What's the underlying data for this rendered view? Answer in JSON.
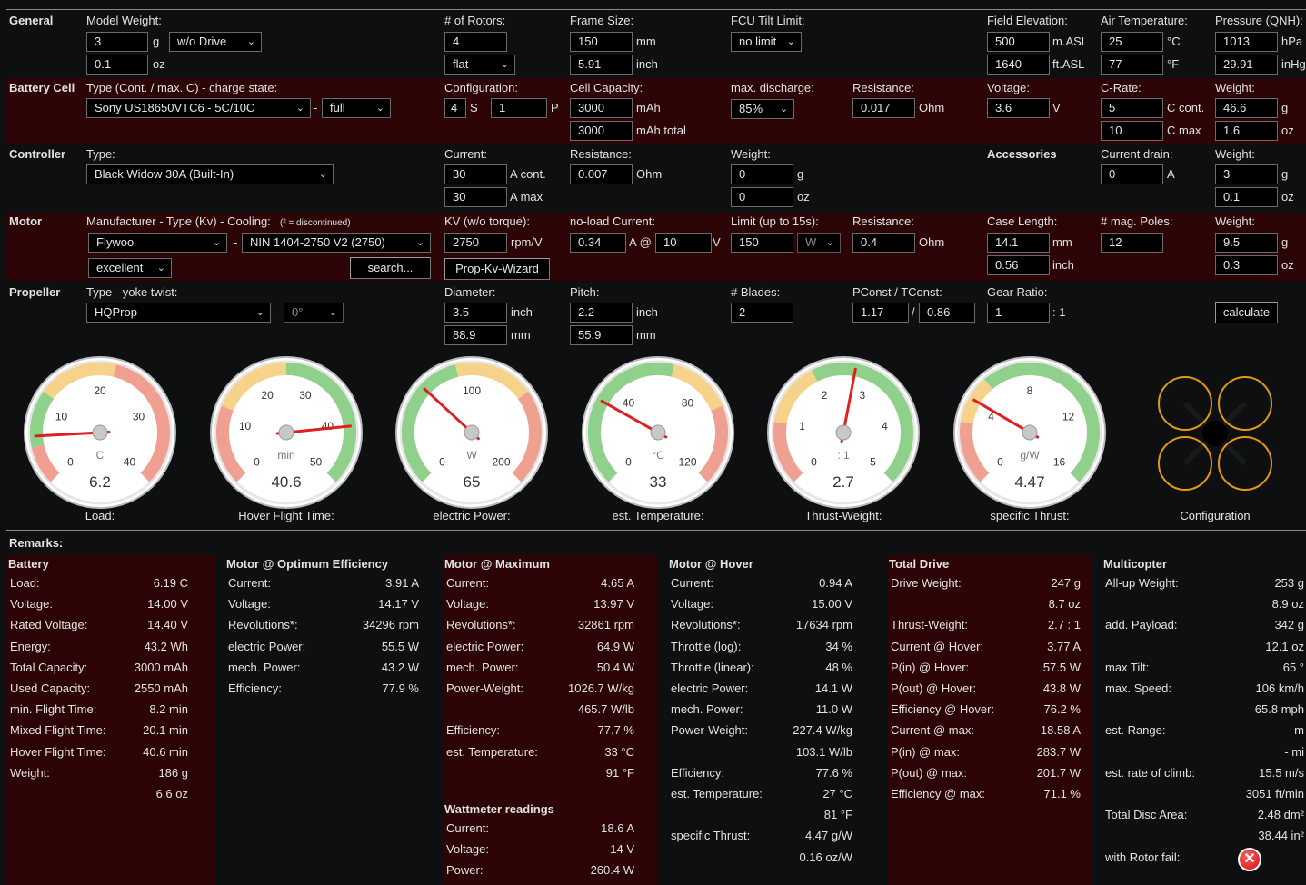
{
  "general": {
    "label": "General",
    "model_weight_label": "Model Weight:",
    "weight_g": "3",
    "unit_g": "g",
    "drive_select": "w/o Drive",
    "weight_oz": "0.1",
    "unit_oz": "oz",
    "rotors_label": "# of Rotors:",
    "rotors": "4",
    "rotor_layout": "flat",
    "frame_label": "Frame Size:",
    "frame_mm": "150",
    "unit_mm": "mm",
    "frame_inch": "5.91",
    "unit_inch": "inch",
    "fcu_label": "FCU Tilt Limit:",
    "fcu_select": "no limit",
    "elev_label": "Field Elevation:",
    "elev_m": "500",
    "unit_masl": "m.ASL",
    "elev_ft": "1640",
    "unit_ftasl": "ft.ASL",
    "air_label": "Air Temperature:",
    "air_c": "25",
    "unit_c": "°C",
    "air_f": "77",
    "unit_f": "°F",
    "pressure_label": "Pressure (QNH):",
    "pressure_hpa": "1013",
    "unit_hpa": "hPa",
    "pressure_inhg": "29.91",
    "unit_inhg": "inHg"
  },
  "battery": {
    "label": "Battery Cell",
    "type_label": "Type (Cont. / max. C) - charge state:",
    "type_select": "Sony US18650VTC6 - 5C/10C",
    "dash": "-",
    "charge_select": "full",
    "config_label": "Configuration:",
    "s_val": "4",
    "s_unit": "S",
    "p_val": "1",
    "p_unit": "P",
    "capacity_label": "Cell Capacity:",
    "capacity": "3000",
    "unit_mah": "mAh",
    "capacity_total": "3000",
    "unit_mah_total": "mAh total",
    "discharge_label": "max. discharge:",
    "discharge_select": "85%",
    "resistance_label": "Resistance:",
    "resistance": "0.017",
    "unit_ohm": "Ohm",
    "voltage_label": "Voltage:",
    "voltage": "3.6",
    "unit_v": "V",
    "crate_label": "C-Rate:",
    "c_cont": "5",
    "unit_ccont": "C cont.",
    "c_max": "10",
    "unit_cmax": "C max",
    "weight_label": "Weight:",
    "weight_g": "46.6",
    "unit_g": "g",
    "weight_oz": "1.6",
    "unit_oz": "oz"
  },
  "controller": {
    "label": "Controller",
    "type_label": "Type:",
    "type_select": "Black Widow 30A (Built-In)",
    "current_label": "Current:",
    "current_cont": "30",
    "unit_acont": "A cont.",
    "current_max": "30",
    "unit_amax": "A max",
    "resistance_label": "Resistance:",
    "resistance": "0.007",
    "unit_ohm": "Ohm",
    "weight_label": "Weight:",
    "weight_g": "0",
    "unit_g": "g",
    "weight_oz": "0",
    "unit_oz": "oz",
    "accessories_label": "Accessories",
    "drain_label": "Current drain:",
    "drain": "0",
    "unit_a": "A",
    "acc_weight_label": "Weight:",
    "acc_weight_g": "3",
    "acc_unit_g": "g",
    "acc_weight_oz": "0.1",
    "acc_unit_oz": "oz"
  },
  "motor": {
    "label": "Motor",
    "mfr_label": "Manufacturer - Type (Kv) - Cooling:",
    "discontinued_note": "(² = discontinued)",
    "mfr_select": "Flywoo",
    "dash": "-",
    "type_select": "NIN 1404-2750 V2 (2750)",
    "cooling_select": "excellent",
    "search_button": "search...",
    "kv_label": "KV (w/o torque):",
    "kv": "2750",
    "unit_rpmv": "rpm/V",
    "wizard_button": "Prop-Kv-Wizard",
    "noload_label": "no-load Current:",
    "noload_a": "0.34",
    "unit_a_at": "A @",
    "noload_v": "10",
    "unit_v": "V",
    "limit_label": "Limit (up to 15s):",
    "limit": "150",
    "limit_unit_select": "W",
    "resistance_label": "Resistance:",
    "resistance": "0.4",
    "unit_ohm": "Ohm",
    "case_label": "Case Length:",
    "case_mm": "14.1",
    "unit_mm": "mm",
    "case_inch": "0.56",
    "unit_inch": "inch",
    "poles_label": "# mag. Poles:",
    "poles": "12",
    "weight_label": "Weight:",
    "weight_g": "9.5",
    "unit_g": "g",
    "weight_oz": "0.3",
    "unit_oz": "oz"
  },
  "propeller": {
    "label": "Propeller",
    "type_label": "Type - yoke twist:",
    "type_select": "HQProp",
    "dash": "-",
    "twist_select": "0°",
    "diameter_label": "Diameter:",
    "diameter_inch": "3.5",
    "unit_inch": "inch",
    "diameter_mm": "88.9",
    "unit_mm": "mm",
    "pitch_label": "Pitch:",
    "pitch_inch": "2.2",
    "pitch_unit_inch": "inch",
    "pitch_mm": "55.9",
    "pitch_unit_mm": "mm",
    "blades_label": "# Blades:",
    "blades": "2",
    "pconst_label": "PConst / TConst:",
    "pconst": "1.17",
    "slash": "/",
    "tconst": "0.86",
    "gear_label": "Gear Ratio:",
    "gear": "1",
    "gear_unit": ": 1",
    "calculate_button": "calculate"
  },
  "gauges": [
    {
      "id": "load",
      "value": "6.2",
      "unit": "C",
      "label": "Load:",
      "ticks": [
        "0",
        "10",
        "20",
        "30",
        "40"
      ],
      "needle": 0.155
    },
    {
      "id": "hover",
      "value": "40.6",
      "unit": "min",
      "label": "Hover Flight Time:",
      "ticks": [
        "0",
        "10",
        "20",
        "30",
        "40",
        "50"
      ],
      "needle": 0.812
    },
    {
      "id": "power",
      "value": "65",
      "unit": "W",
      "label": "electric Power:",
      "ticks": [
        "0",
        "100",
        "200"
      ],
      "needle": 0.325
    },
    {
      "id": "temp",
      "value": "33",
      "unit": "°C",
      "label": "est. Temperature:",
      "ticks": [
        "0",
        "40",
        "80",
        "120"
      ],
      "needle": 0.275
    },
    {
      "id": "thrust",
      "value": "2.7",
      "unit": ": 1",
      "label": "Thrust-Weight:",
      "ticks": [
        "0",
        "1",
        "2",
        "3",
        "4",
        "5"
      ],
      "needle": 0.54
    },
    {
      "id": "specific",
      "value": "4.47",
      "unit": "g/W",
      "label": "specific Thrust:",
      "ticks": [
        "0",
        "4",
        "8",
        "12",
        "16"
      ],
      "needle": 0.279
    }
  ],
  "config_label": "Configuration",
  "remarks_label": "Remarks:",
  "results": {
    "battery": {
      "title": "Battery",
      "rows": [
        [
          "Load:",
          "6.19 C"
        ],
        [
          "Voltage:",
          "14.00 V"
        ],
        [
          "Rated Voltage:",
          "14.40 V"
        ],
        [
          "Energy:",
          "43.2 Wh"
        ],
        [
          "Total Capacity:",
          "3000 mAh"
        ],
        [
          "Used Capacity:",
          "2550 mAh"
        ],
        [
          "min. Flight Time:",
          "8.2 min"
        ],
        [
          "Mixed Flight Time:",
          "20.1 min"
        ],
        [
          "Hover Flight Time:",
          "40.6 min"
        ],
        [
          "Weight:",
          "186 g"
        ],
        [
          "",
          "6.6 oz"
        ]
      ]
    },
    "optimum": {
      "title": "Motor @ Optimum Efficiency",
      "rows": [
        [
          "Current:",
          "3.91 A"
        ],
        [
          "Voltage:",
          "14.17 V"
        ],
        [
          "Revolutions*:",
          "34296 rpm"
        ],
        [
          "electric Power:",
          "55.5 W"
        ],
        [
          "mech. Power:",
          "43.2 W"
        ],
        [
          "Efficiency:",
          "77.9 %"
        ]
      ]
    },
    "maximum": {
      "title": "Motor @ Maximum",
      "rows": [
        [
          "Current:",
          "4.65 A"
        ],
        [
          "Voltage:",
          "13.97 V"
        ],
        [
          "Revolutions*:",
          "32861 rpm"
        ],
        [
          "electric Power:",
          "64.9 W"
        ],
        [
          "mech. Power:",
          "50.4 W"
        ],
        [
          "Power-Weight:",
          "1026.7 W/kg"
        ],
        [
          "",
          "465.7 W/lb"
        ],
        [
          "Efficiency:",
          "77.7 %"
        ],
        [
          "est. Temperature:",
          "33 °C"
        ],
        [
          "",
          "91 °F"
        ]
      ],
      "watt_title": "Wattmeter readings",
      "watt_rows": [
        [
          "Current:",
          "18.6 A"
        ],
        [
          "Voltage:",
          "14 V"
        ],
        [
          "Power:",
          "260.4 W"
        ]
      ]
    },
    "hover": {
      "title": "Motor @ Hover",
      "rows": [
        [
          "Current:",
          "0.94 A"
        ],
        [
          "Voltage:",
          "15.00 V"
        ],
        [
          "Revolutions*:",
          "17634 rpm"
        ],
        [
          "Throttle (log):",
          "34 %"
        ],
        [
          "Throttle (linear):",
          "48 %"
        ],
        [
          "electric Power:",
          "14.1 W"
        ],
        [
          "mech. Power:",
          "11.0 W"
        ],
        [
          "Power-Weight:",
          "227.4 W/kg"
        ],
        [
          "",
          "103.1 W/lb"
        ],
        [
          "Efficiency:",
          "77.6 %"
        ],
        [
          "est. Temperature:",
          "27 °C"
        ],
        [
          "",
          "81 °F"
        ],
        [
          "specific Thrust:",
          "4.47 g/W"
        ],
        [
          "",
          "0.16 oz/W"
        ]
      ]
    },
    "drive": {
      "title": "Total Drive",
      "rows": [
        [
          "Drive Weight:",
          "247 g"
        ],
        [
          "",
          "8.7 oz"
        ],
        [
          "Thrust-Weight:",
          "2.7 : 1"
        ],
        [
          "Current @ Hover:",
          "3.77 A"
        ],
        [
          "P(in) @ Hover:",
          "57.5 W"
        ],
        [
          "P(out) @ Hover:",
          "43.8 W"
        ],
        [
          "Efficiency @ Hover:",
          "76.2 %"
        ],
        [
          "Current @ max:",
          "18.58 A"
        ],
        [
          "P(in) @ max:",
          "283.7 W"
        ],
        [
          "P(out) @ max:",
          "201.7 W"
        ],
        [
          "Efficiency @ max:",
          "71.1 %"
        ]
      ]
    },
    "multicopter": {
      "title": "Multicopter",
      "rows": [
        [
          "All-up Weight:",
          "253 g"
        ],
        [
          "",
          "8.9 oz"
        ],
        [
          "add. Payload:",
          "342 g"
        ],
        [
          "",
          "12.1 oz"
        ],
        [
          "max Tilt:",
          "65 °"
        ],
        [
          "max. Speed:",
          "106 km/h"
        ],
        [
          "",
          "65.8 mph"
        ],
        [
          "est. Range:",
          "- m"
        ],
        [
          "",
          "- mi"
        ],
        [
          "est. rate of climb:",
          "15.5 m/s"
        ],
        [
          "",
          "3051 ft/min"
        ],
        [
          "Total Disc Area:",
          "2.48 dm²"
        ],
        [
          "",
          "38.44 in²"
        ],
        [
          "with Rotor fail:",
          ""
        ]
      ]
    }
  }
}
